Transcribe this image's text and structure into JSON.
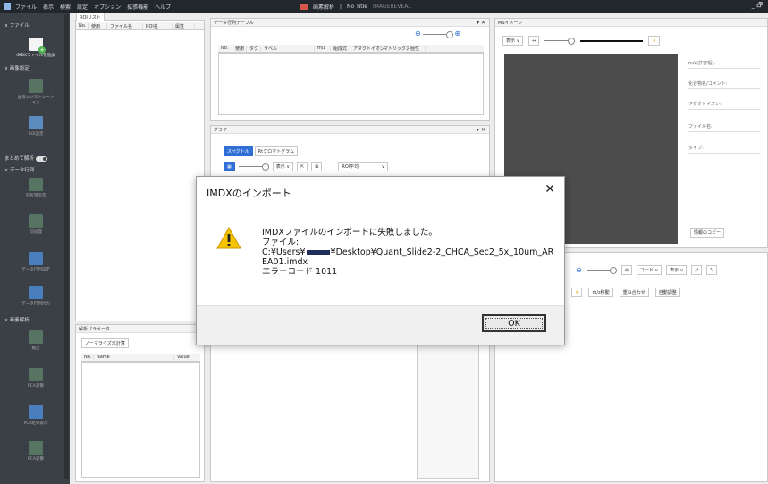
{
  "titlebar": {
    "menu": [
      "ファイル",
      "表示",
      "検索",
      "設定",
      "オプション",
      "拡張機能",
      "ヘルプ"
    ],
    "mode": "画素解析",
    "separator": "|",
    "file": "No Title",
    "app": "IMAGEREVEAL",
    "window_controls": "_ 🗗"
  },
  "sidebar": {
    "file_section": "ファイル",
    "import_label": "IMDXファイルを追加",
    "image_settings_section": "画像設定",
    "image_settings_tools": [
      "画像レジストレーション",
      "ROI設定"
    ],
    "batch_label": "まとめて解析",
    "data_section": "データ行列",
    "data_tools": [
      "前処理設定",
      "前処理",
      "データ行列設定",
      "データ行列出力"
    ],
    "analysis_section": "画素解析",
    "analysis_tools": [
      "検定",
      "PCA計算",
      "PCA結果表示",
      "PCA計算"
    ]
  },
  "roi_list": {
    "tab": "ROIリスト",
    "columns": [
      "No.",
      "使用",
      "ファイル名",
      "ROI名",
      "属性"
    ]
  },
  "data_table": {
    "title": "データ行列テーブル",
    "columns": [
      "No.",
      "使用",
      "タグ",
      "ラベル",
      "m/z",
      "組成式",
      "アダクトイオン",
      "マトリックス",
      "極性"
    ]
  },
  "graph": {
    "title": "グラフ",
    "tabs": [
      "スペクトル",
      "Rtクロマトグラム"
    ],
    "display_label": "表示 ∨",
    "roi_select": "ROI平均"
  },
  "ms_image": {
    "title": "MSイメージ",
    "display_label": "表示 ∨",
    "fields": [
      "m/z(許容幅):",
      "化合物名/コメント:",
      "アダクトイオン:",
      "ファイル名:",
      "タイプ:"
    ],
    "copy_button": "情報のコピー",
    "color_select": "コード ∨",
    "disp_select": "表示 ∨",
    "buttons": [
      "m/z移動",
      "重ね合わせ",
      "自動調整"
    ]
  },
  "params": {
    "title": "解析パラメータ",
    "button": "ノーマライズ未計算",
    "columns": [
      "No.",
      "Name",
      "Value"
    ]
  },
  "dialog": {
    "title": "IMDXのインポート",
    "close": "✕",
    "message_line1": "IMDXファイルのインポートに失敗しました。",
    "message_line2": "ファイル:",
    "path_prefix": "C:¥Users¥",
    "path_suffix": "¥Desktop¥Quant_Slide2-2_CHCA_Sec2_5x_10um_AREA01.imdx",
    "error_code": "エラーコード 1011",
    "ok_button": "OK",
    "warning_icon": "warning-icon"
  }
}
